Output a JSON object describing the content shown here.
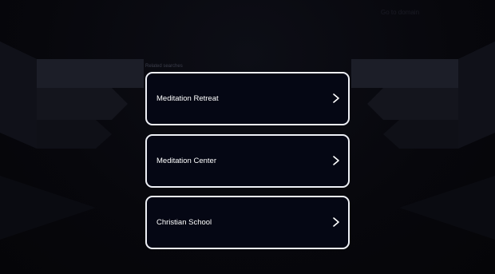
{
  "header": {
    "top_link": "Go to domain"
  },
  "related": {
    "heading": "Related searches",
    "items": [
      {
        "label": "Meditation Retreat",
        "icon": "chevron-right-icon"
      },
      {
        "label": "Meditation Center",
        "icon": "chevron-right-icon"
      },
      {
        "label": "Christian School",
        "icon": "chevron-right-icon"
      }
    ]
  },
  "colors": {
    "background": "#07070c",
    "card_background": "#050714",
    "card_border": "#eef0f6",
    "text": "#ffffff"
  }
}
